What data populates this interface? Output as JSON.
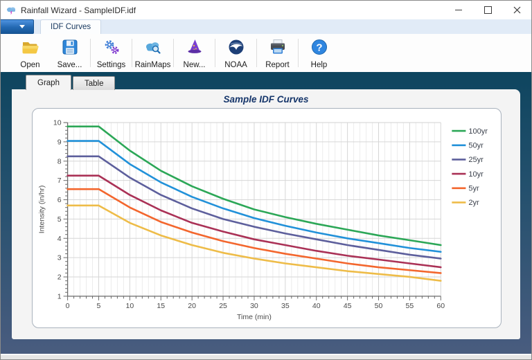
{
  "window": {
    "title": "Rainfall Wizard - SampleIDF.idf",
    "app_icon": "rain-cloud-icon",
    "controls": [
      {
        "name": "minimize-button",
        "icon": "minimize-icon"
      },
      {
        "name": "maximize-button",
        "icon": "maximize-icon"
      },
      {
        "name": "close-button",
        "icon": "close-icon"
      }
    ]
  },
  "ribbon": {
    "app_menu_icon": "dropdown-caret-icon",
    "tab": "IDF Curves"
  },
  "toolbar": {
    "buttons": [
      {
        "label": "Open",
        "icon": "folder-open-icon",
        "separator_after": false
      },
      {
        "label": "Save...",
        "icon": "floppy-disk-icon",
        "separator_after": true
      },
      {
        "label": "Settings",
        "icon": "gears-icon",
        "separator_after": true
      },
      {
        "label": "RainMaps",
        "icon": "cloud-search-icon",
        "separator_after": true
      },
      {
        "label": "New...",
        "icon": "wizard-hat-icon",
        "separator_after": true
      },
      {
        "label": "NOAA",
        "icon": "noaa-logo-icon",
        "separator_after": true
      },
      {
        "label": "Report",
        "icon": "printer-icon",
        "separator_after": true
      },
      {
        "label": "Help",
        "icon": "question-mark-icon",
        "separator_after": false
      }
    ]
  },
  "page_tabs": [
    {
      "label": "Graph",
      "active": true
    },
    {
      "label": "Table",
      "active": false
    }
  ],
  "colors": {
    "frame_gradient_top": "#0e455f",
    "frame_gradient_bottom": "#495c7f",
    "ribbon_strip": "#e1ebf7",
    "app_menu_blue": "#2368b2",
    "chart_title_navy": "#15356a",
    "grid_minor": "#ececec",
    "grid_major": "#d6d6d6",
    "axis": "#6b6b6b",
    "tick_label": "#4a4a4a",
    "legend_text": "#3c424d"
  },
  "chart_data": {
    "type": "line",
    "title": "Sample IDF Curves",
    "xlabel": "Time (min)",
    "ylabel": "Intensity (in/hr)",
    "xlim": [
      0,
      60
    ],
    "ylim": [
      1,
      10
    ],
    "x_major_tick": 5,
    "x_minor_tick": 1,
    "y_major_tick": 1,
    "y_minor_tick": 0.2,
    "grid": true,
    "legend_position": "right",
    "x": [
      0,
      5,
      10,
      15,
      20,
      25,
      30,
      35,
      40,
      45,
      50,
      55,
      60
    ],
    "series": [
      {
        "name": "100yr",
        "color": "#2ca757",
        "values": [
          9.8,
          9.8,
          8.55,
          7.5,
          6.7,
          6.05,
          5.5,
          5.1,
          4.75,
          4.45,
          4.15,
          3.9,
          3.65
        ]
      },
      {
        "name": "50yr",
        "color": "#2191d9",
        "values": [
          9.05,
          9.05,
          7.85,
          6.9,
          6.15,
          5.55,
          5.05,
          4.65,
          4.3,
          4.0,
          3.75,
          3.5,
          3.3
        ]
      },
      {
        "name": "25yr",
        "color": "#5d5f9c",
        "values": [
          8.25,
          8.25,
          7.15,
          6.25,
          5.55,
          5.0,
          4.6,
          4.25,
          3.95,
          3.65,
          3.4,
          3.15,
          2.95
        ]
      },
      {
        "name": "10yr",
        "color": "#aa3156",
        "values": [
          7.25,
          7.25,
          6.25,
          5.45,
          4.8,
          4.35,
          3.95,
          3.65,
          3.35,
          3.1,
          2.9,
          2.7,
          2.5
        ]
      },
      {
        "name": "5yr",
        "color": "#f3662d",
        "values": [
          6.55,
          6.55,
          5.6,
          4.85,
          4.3,
          3.85,
          3.5,
          3.2,
          2.95,
          2.7,
          2.5,
          2.35,
          2.2
        ]
      },
      {
        "name": "2yr",
        "color": "#eebc48",
        "values": [
          5.7,
          5.7,
          4.8,
          4.15,
          3.65,
          3.25,
          2.95,
          2.7,
          2.5,
          2.3,
          2.15,
          2.0,
          1.8
        ]
      }
    ]
  }
}
